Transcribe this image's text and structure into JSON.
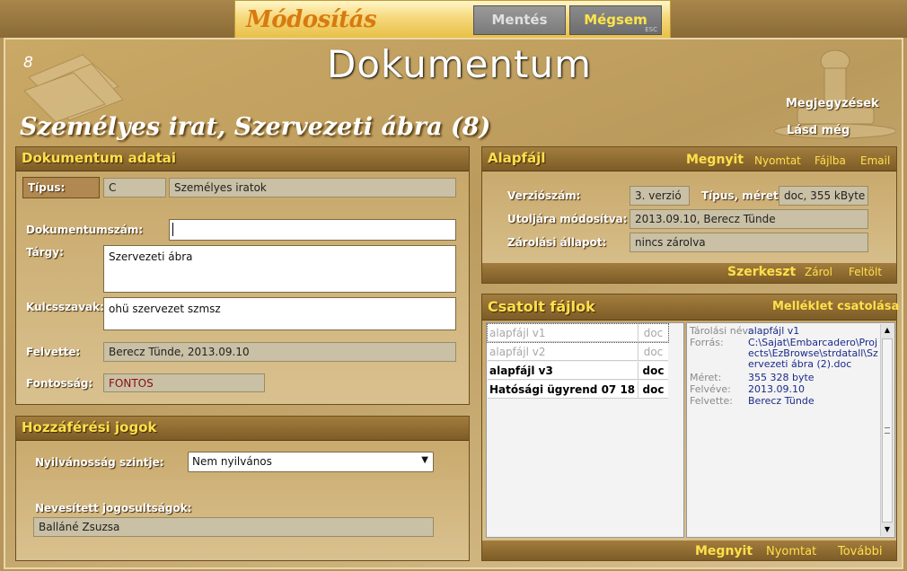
{
  "topbar": {
    "mode_title": "Módosítás",
    "save_label": "Mentés",
    "cancel_label": "Mégsem",
    "cancel_hint": "ESC"
  },
  "header": {
    "doc_number": "8",
    "page_title": "Dokumentum",
    "subtitle": "Személyes irat, Szervezeti ábra (8)",
    "notes_link": "Megjegyzések",
    "see_also_link": "Lásd még"
  },
  "doc_data": {
    "title": "Dokumentum adatai",
    "type_label": "Típus:",
    "type_code": "C",
    "type_name": "Személyes iratok",
    "docnum_label": "Dokumentumszám:",
    "docnum_value": "",
    "subject_label": "Tárgy:",
    "subject_value": "Szervezeti ábra",
    "keywords_label": "Kulcsszavak:",
    "keywords_value": "ohü szervezet szmsz",
    "created_label": "Felvette:",
    "created_value": "Berecz Tünde, 2013.09.10",
    "importance_label": "Fontosság:",
    "importance_value": "FONTOS"
  },
  "access": {
    "title": "Hozzáférési jogok",
    "visibility_label": "Nyilvánosság szintje:",
    "visibility_value": "Nem nyilvános",
    "named_label": "Nevesített jogosultságok:",
    "named_value": "Balláné Zsuzsa"
  },
  "basefile": {
    "title": "Alapfájl",
    "open": "Megnyit",
    "print": "Nyomtat",
    "to_file": "Fájlba",
    "email": "Email",
    "version_label": "Verziószám:",
    "version_value": "3. verzió",
    "typesize_label": "Típus, méret:",
    "typesize_value": "doc, 355 kByte",
    "modified_label": "Utoljára módosítva:",
    "modified_value": "2013.09.10, Berecz Tünde",
    "lock_label": "Zárolási állapot:",
    "lock_value": "nincs zárolva",
    "edit": "Szerkeszt",
    "lock": "Zárol",
    "upload": "Feltölt"
  },
  "attached": {
    "title": "Csatolt fájlok",
    "attach_link": "Melléklet csatolása",
    "files": [
      {
        "name": "alapfájl v1",
        "ext": "doc",
        "style": "dim"
      },
      {
        "name": "alapfájl v2",
        "ext": "doc",
        "style": "dim"
      },
      {
        "name": "alapfájl v3",
        "ext": "doc",
        "style": "bold"
      },
      {
        "name": "Hatósági ügyrend 07 18",
        "ext": "doc",
        "style": "bold"
      }
    ],
    "detail": {
      "storage_label": "Tárolási név:",
      "storage_value": "alapfájl v1",
      "source_label": "Forrás:",
      "source_value": "C:\\Sajat\\Embarcadero\\Projects\\EzBrowse\\strdatall\\Szervezeti ábra (2).doc",
      "size_label": "Méret:",
      "size_value": "355 328 byte",
      "added_label": "Felvéve:",
      "added_value": "2013.09.10",
      "by_label": "Felvette:",
      "by_value": "Berecz Tünde"
    },
    "open": "Megnyit",
    "print": "Nyomtat",
    "more": "További"
  }
}
